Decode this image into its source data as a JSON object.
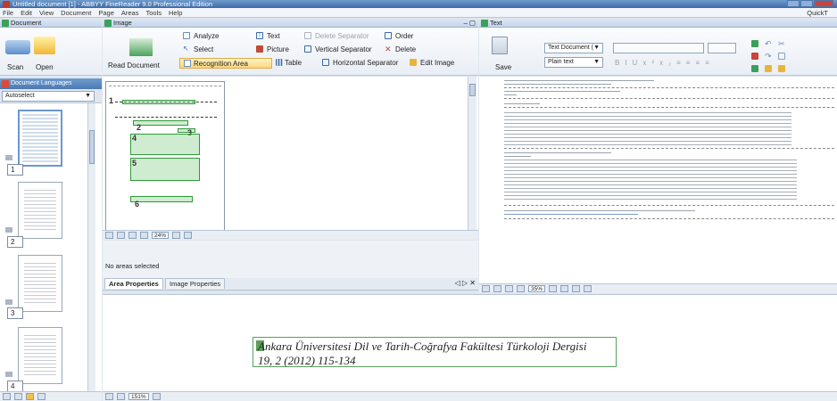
{
  "window": {
    "title": "Untitled document [1] - ABBYY FineReader 9.0 Professional Edition"
  },
  "menu": [
    "File",
    "Edit",
    "View",
    "Document",
    "Page",
    "Areas",
    "Tools",
    "Help"
  ],
  "quick": "QuickT",
  "document_pane": {
    "title": "Document",
    "scan_label": "Scan",
    "open_label": "Open",
    "languages_title": "Document Languages",
    "language_value": "Autoselect",
    "pages": [
      "1",
      "2",
      "3",
      "4"
    ]
  },
  "image_pane": {
    "title": "Image",
    "read_label": "Read Document",
    "tools": {
      "analyze": "Analyze",
      "select": "Select",
      "recognition_area": "Recognition Area",
      "text": "Text",
      "picture": "Picture",
      "table": "Table",
      "delete_separator": "Delete Separator",
      "vertical_separator": "Vertical Separator",
      "horizontal_separator": "Horizontal Separator",
      "order": "Order",
      "delete": "Delete",
      "edit_image": "Edit Image"
    },
    "zoom": "24%",
    "area_numbers": [
      "1",
      "2",
      "3",
      "4",
      "5",
      "6"
    ]
  },
  "properties": {
    "no_areas": "No areas selected",
    "tab_area": "Area Properties",
    "tab_image": "Image Properties"
  },
  "text_pane": {
    "title": "Text",
    "save_label": "Save",
    "format_value": "Text Document (",
    "plain_value": "Plain text",
    "zoom": "35%"
  },
  "zoom_pane": {
    "line1": "Ankara Üniversitesi Dil ve Tarih-Coğrafya Fakültesi Türkoloji Dergisi",
    "line2": "19, 2 (2012) 115-134",
    "zoom": "151%"
  },
  "colors": {
    "titlebar": "#3d6aa6",
    "green_area": "#2f9a3b",
    "zoom_border": "#5c9f5c"
  }
}
